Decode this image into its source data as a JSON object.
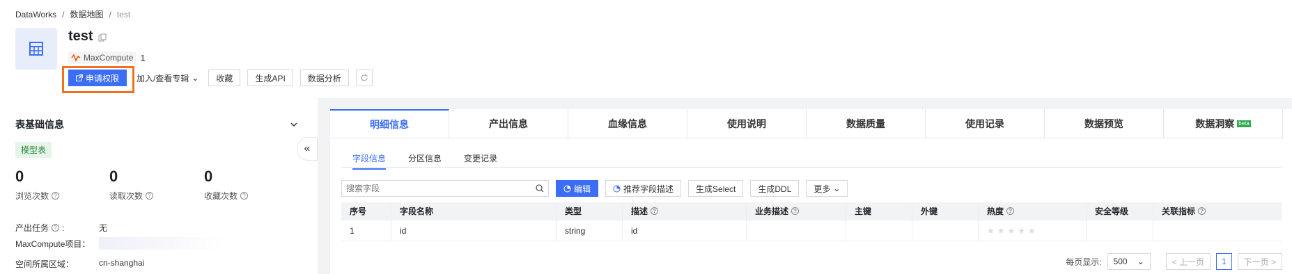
{
  "breadcrumb": [
    "DataWorks",
    "数据地图",
    "test"
  ],
  "table_name": "test",
  "source": {
    "engine": "MaxCompute",
    "count": "1"
  },
  "actions": {
    "apply": "申请权限",
    "album": "加入/查看专辑",
    "favorite": "收藏",
    "gen_api": "生成API",
    "analysis": "数据分析"
  },
  "left_panel": {
    "title": "表基础信息",
    "badge": "模型表",
    "stats": [
      {
        "value": "0",
        "label": "浏览次数"
      },
      {
        "value": "0",
        "label": "读取次数"
      },
      {
        "value": "0",
        "label": "收藏次数"
      }
    ],
    "props": [
      {
        "key": "产出任务",
        "value": "无"
      },
      {
        "key": "MaxCompute项目：",
        "value": ""
      },
      {
        "key": "空间所属区域：",
        "value": "cn-shanghai"
      }
    ]
  },
  "tabs": [
    "明细信息",
    "产出信息",
    "血缘信息",
    "使用说明",
    "数据质量",
    "使用记录",
    "数据预览",
    "数据洞察"
  ],
  "tab_badge": "beta",
  "subtabs": [
    "字段信息",
    "分区信息",
    "变更记录"
  ],
  "toolbar": {
    "search_placeholder": "搜索字段",
    "edit": "编辑",
    "recommend": "推荐字段描述",
    "gen_select": "生成Select",
    "gen_ddl": "生成DDL",
    "more": "更多"
  },
  "columns": [
    "序号",
    "字段名称",
    "类型",
    "描述",
    "业务描述",
    "主键",
    "外键",
    "热度",
    "安全等级",
    "关联指标"
  ],
  "rows": [
    [
      "1",
      "id",
      "string",
      "id",
      "",
      "",
      "",
      "★★★★★",
      "",
      ""
    ]
  ],
  "pager": {
    "per_page_label": "每页显示:",
    "per_page": "500",
    "prev": "< 上一页",
    "current": "1",
    "next": "下一页 >"
  }
}
